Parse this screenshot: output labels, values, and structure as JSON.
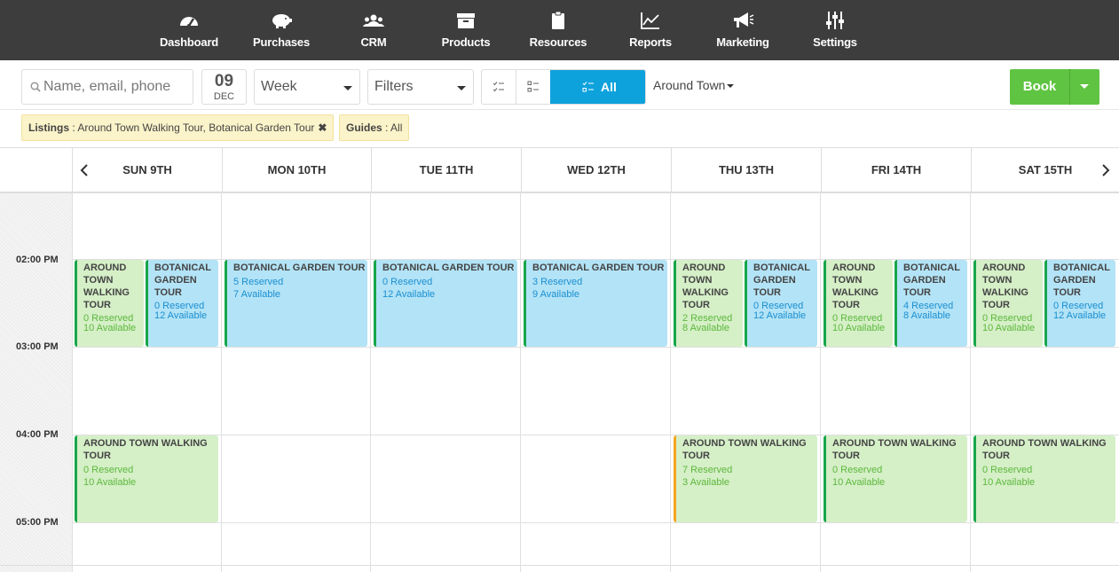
{
  "nav": [
    {
      "label": "Dashboard",
      "icon": "dashboard-gauge-icon"
    },
    {
      "label": "Purchases",
      "icon": "piggy-bank-icon"
    },
    {
      "label": "CRM",
      "icon": "users-icon"
    },
    {
      "label": "Products",
      "icon": "archive-box-icon"
    },
    {
      "label": "Resources",
      "icon": "clipboard-icon"
    },
    {
      "label": "Reports",
      "icon": "line-chart-icon"
    },
    {
      "label": "Marketing",
      "icon": "megaphone-icon"
    },
    {
      "label": "Settings",
      "icon": "sliders-icon"
    }
  ],
  "toolbar": {
    "search_placeholder": "Name, email, phone",
    "date_day": "09",
    "date_month": "DEC",
    "view": "Week",
    "filters": "Filters",
    "all_label": "All",
    "location": "Around Town",
    "book_label": "Book"
  },
  "chips": {
    "listings_key": "Listings",
    "listings_value": " : Around Town Walking Tour, Botanical Garden Tour",
    "guides_key": "Guides",
    "guides_value": " : All"
  },
  "calendar": {
    "days": [
      "SUN 9TH",
      "MON 10TH",
      "TUE 11TH",
      "WED 12TH",
      "THU 13TH",
      "FRI 14TH",
      "SAT 15TH"
    ],
    "times": [
      "02:00 PM",
      "03:00 PM",
      "04:00 PM",
      "05:00 PM"
    ],
    "events": [
      {
        "day": 0,
        "slot": "2pm",
        "part": "left",
        "title": "AROUND TOWN WALKING TOUR",
        "reserved": "0 Reserved",
        "available": "10 Available",
        "color": "green"
      },
      {
        "day": 0,
        "slot": "2pm",
        "part": "right",
        "title": "BOTANICAL GARDEN TOUR",
        "reserved": "0 Reserved",
        "available": "12 Available",
        "color": "blue"
      },
      {
        "day": 1,
        "slot": "2pm",
        "part": "full",
        "title": "BOTANICAL GARDEN TOUR",
        "reserved": "5 Reserved",
        "available": "7 Available",
        "color": "blue"
      },
      {
        "day": 2,
        "slot": "2pm",
        "part": "full",
        "title": "BOTANICAL GARDEN TOUR",
        "reserved": "0 Reserved",
        "available": "12 Available",
        "color": "blue"
      },
      {
        "day": 3,
        "slot": "2pm",
        "part": "full",
        "title": "BOTANICAL GARDEN TOUR",
        "reserved": "3 Reserved",
        "available": "9 Available",
        "color": "blue"
      },
      {
        "day": 4,
        "slot": "2pm",
        "part": "left",
        "title": "AROUND TOWN WALKING TOUR",
        "reserved": "2 Reserved",
        "available": "8 Available",
        "color": "green"
      },
      {
        "day": 4,
        "slot": "2pm",
        "part": "right",
        "title": "BOTANICAL GARDEN TOUR",
        "reserved": "0 Reserved",
        "available": "12 Available",
        "color": "blue"
      },
      {
        "day": 5,
        "slot": "2pm",
        "part": "left",
        "title": "AROUND TOWN WALKING TOUR",
        "reserved": "0 Reserved",
        "available": "10 Available",
        "color": "green"
      },
      {
        "day": 5,
        "slot": "2pm",
        "part": "right",
        "title": "BOTANICAL GARDEN TOUR",
        "reserved": "4 Reserved",
        "available": "8 Available",
        "color": "blue"
      },
      {
        "day": 6,
        "slot": "2pm",
        "part": "left",
        "title": "AROUND TOWN WALKING TOUR",
        "reserved": "0 Reserved",
        "available": "10 Available",
        "color": "green"
      },
      {
        "day": 6,
        "slot": "2pm",
        "part": "right",
        "title": "BOTANICAL GARDEN TOUR",
        "reserved": "0 Reserved",
        "available": "12 Available",
        "color": "blue"
      },
      {
        "day": 0,
        "slot": "4pm",
        "part": "full",
        "title": "AROUND TOWN WALKING TOUR",
        "reserved": "0 Reserved",
        "available": "10 Available",
        "color": "green"
      },
      {
        "day": 4,
        "slot": "4pm",
        "part": "full",
        "title": "AROUND TOWN WALKING TOUR",
        "reserved": "7 Reserved",
        "available": "3 Available",
        "color": "green",
        "accent": "orange"
      },
      {
        "day": 5,
        "slot": "4pm",
        "part": "full",
        "title": "AROUND TOWN WALKING TOUR",
        "reserved": "0 Reserved",
        "available": "10 Available",
        "color": "green"
      },
      {
        "day": 6,
        "slot": "4pm",
        "part": "full",
        "title": "AROUND TOWN WALKING TOUR",
        "reserved": "0 Reserved",
        "available": "10 Available",
        "color": "green"
      }
    ]
  }
}
